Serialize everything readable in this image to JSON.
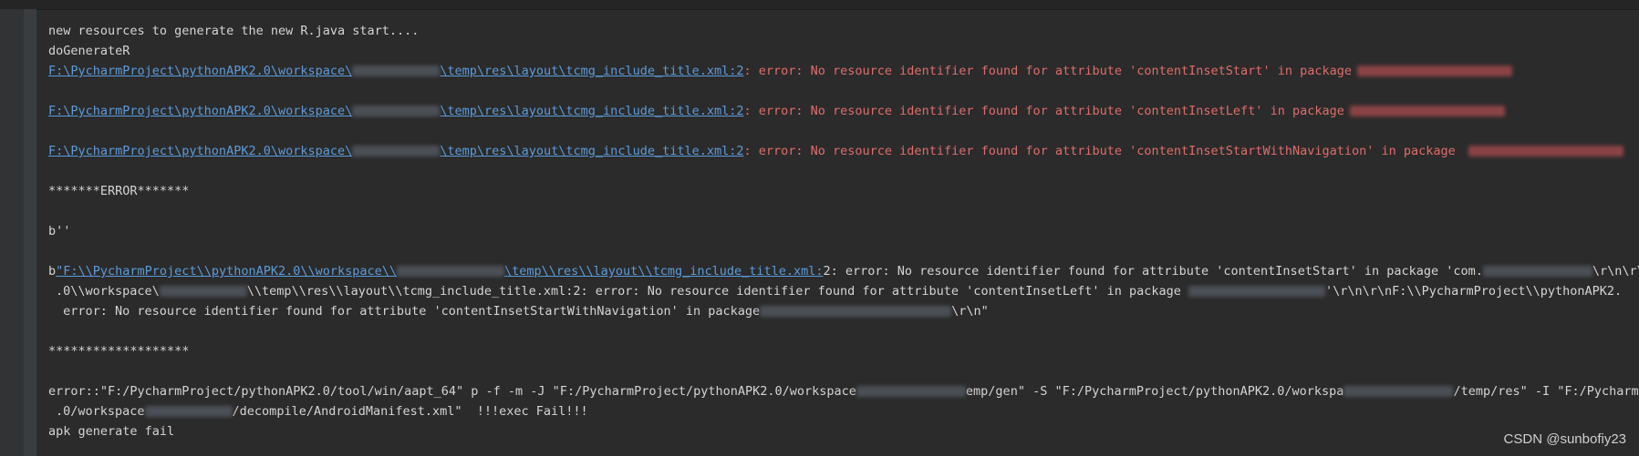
{
  "console": {
    "line1": "new resources to generate the new R.java start....",
    "line2": "doGenerateR",
    "err_lines": [
      {
        "path_prefix": "F:\\PycharmProject\\pythonAPK2.0\\workspace\\",
        "path_suffix": "\\temp\\res\\layout\\tcmg_include_title.xml:2",
        "message": ": error: No resource identifier found for attribute 'contentInsetStart' in package"
      },
      {
        "path_prefix": "F:\\PycharmProject\\pythonAPK2.0\\workspace\\",
        "path_suffix": "\\temp\\res\\layout\\tcmg_include_title.xml:2",
        "message": ": error: No resource identifier found for attribute 'contentInsetLeft' in package"
      },
      {
        "path_prefix": "F:\\PycharmProject\\pythonAPK2.0\\workspace\\",
        "path_suffix": "\\temp\\res\\layout\\tcmg_include_title.xml:2",
        "message": ": error: No resource identifier found for attribute 'contentInsetStartWithNavigation' in package"
      }
    ],
    "error_header": "*******ERROR*******",
    "bytes_empty": "b''",
    "bytes_block": {
      "lead": "b",
      "link_prefix": "\"F:\\\\PycharmProject\\\\pythonAPK2.0\\\\workspace\\\\",
      "link_suffix": "\\temp\\\\res\\\\layout\\\\tcmg_include_title.xml:",
      "rest1": "2: error: No resource identifier found for attribute 'contentInsetStart' in package 'com.",
      "tail1": "\\r\\n\\r\\",
      "l2_start": ".0\\\\workspace\\",
      "l2_mid": "\\\\temp\\\\res\\\\layout\\\\tcmg_include_title.xml:2: error: No resource identifier found for attribute 'contentInsetLeft' in package ",
      "l2_end": "'\\r\\n\\r\\nF:\\\\PycharmProject\\\\pythonAPK2.",
      "l3_start": " error: No resource identifier found for attribute 'contentInsetStartWithNavigation' in package",
      "l3_end": "\\r\\n\""
    },
    "stars": "*******************",
    "cmd": {
      "l1_start": "error::\"F:/PycharmProject/pythonAPK2.0/tool/win/aapt_64\" p -f -m -J \"F:/PycharmProject/pythonAPK2.0/workspace",
      "l1_mid": "emp/gen\" -S \"F:/PycharmProject/pythonAPK2.0/workspa",
      "l1_end": "/temp/res\" -I \"F:/PycharmP",
      "l2_start": ".0/workspace",
      "l2_end": "/decompile/AndroidManifest.xml\"  !!!exec Fail!!!"
    },
    "final": "apk generate fail"
  },
  "watermark": "CSDN @sunbofiy23"
}
